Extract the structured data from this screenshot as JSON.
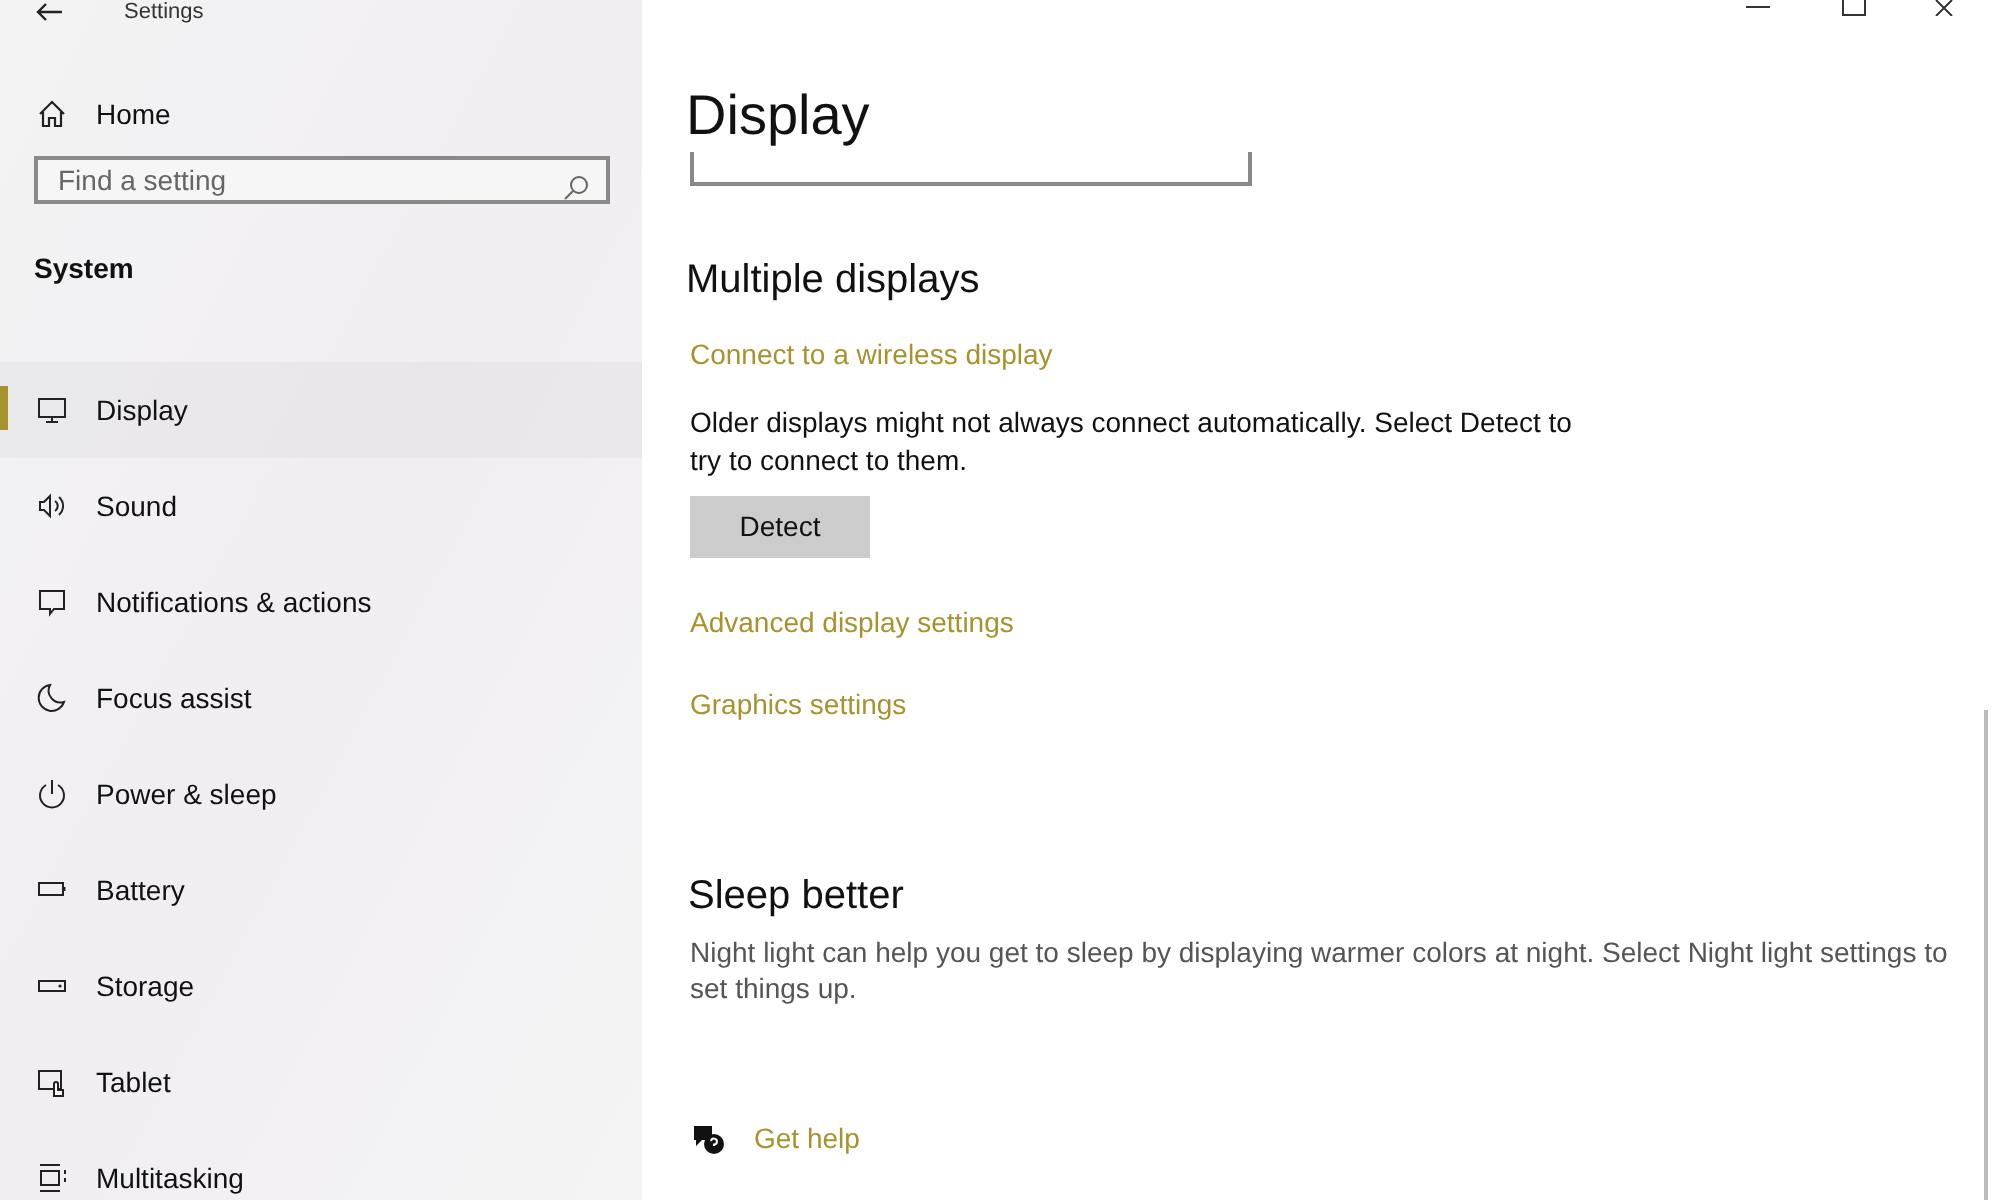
{
  "window": {
    "title": "Settings"
  },
  "sidebar": {
    "home": "Home",
    "search": {
      "placeholder": "Find a setting"
    },
    "section": "System",
    "items": [
      {
        "label": "Display",
        "kind": "display",
        "selected": true
      },
      {
        "label": "Sound",
        "kind": "sound",
        "selected": false
      },
      {
        "label": "Notifications & actions",
        "kind": "notifications",
        "selected": false
      },
      {
        "label": "Focus assist",
        "kind": "focus",
        "selected": false
      },
      {
        "label": "Power & sleep",
        "kind": "power",
        "selected": false
      },
      {
        "label": "Battery",
        "kind": "battery",
        "selected": false
      },
      {
        "label": "Storage",
        "kind": "storage",
        "selected": false
      },
      {
        "label": "Tablet",
        "kind": "tablet",
        "selected": false
      },
      {
        "label": "Multitasking",
        "kind": "multitasking",
        "selected": false
      }
    ]
  },
  "content": {
    "title": "Display",
    "multiple_displays": {
      "heading": "Multiple displays",
      "link": "Connect to a wireless display",
      "description": "Older displays might not always connect automatically. Select Detect to try to connect to them.",
      "button": "Detect"
    },
    "links": [
      "Advanced display settings",
      "Graphics settings"
    ],
    "sleep_better": {
      "heading": "Sleep better",
      "description": "Night light can help you get to sleep by displaying warmer colors at night. Select Night light settings to set things up."
    },
    "help": "Get help"
  }
}
